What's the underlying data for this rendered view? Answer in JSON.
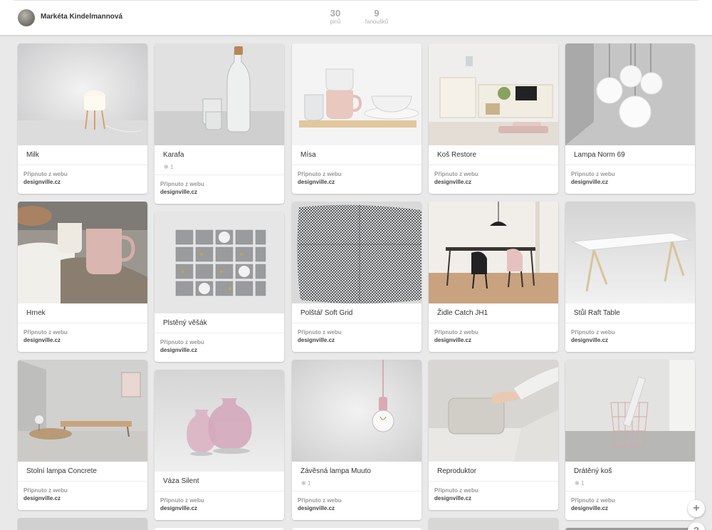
{
  "profile": {
    "name": "Markéta Kindelmannová"
  },
  "stats": [
    {
      "value": "30",
      "label": "pinů"
    },
    {
      "value": "9",
      "label": "fanoušků"
    }
  ],
  "source_label": "Připnuto z webu",
  "pins": [
    {
      "title": "Milk",
      "site": "designville.cz",
      "icon": "table-lamp-photo"
    },
    {
      "title": "Karafa",
      "site": "designville.cz",
      "likes": "1",
      "icon": "carafe-photo"
    },
    {
      "title": "Mísa",
      "site": "designville.cz",
      "icon": "bowls-mugs-photo"
    },
    {
      "title": "Koš Restore",
      "site": "designville.cz",
      "icon": "shelving-room-photo"
    },
    {
      "title": "Lampa Norm 69",
      "site": "designville.cz",
      "icon": "pendant-lamps-photo"
    },
    {
      "title": "Hrnek",
      "site": "designville.cz",
      "icon": "mug-photo"
    },
    {
      "title": "Plstěný věšák",
      "site": "designville.cz",
      "icon": "felt-hanger-photo"
    },
    {
      "title": "Polštář Soft Grid",
      "site": "designville.cz",
      "icon": "cushion-photo"
    },
    {
      "title": "Židle Catch JH1",
      "site": "designville.cz",
      "icon": "dining-room-photo"
    },
    {
      "title": "Stůl Raft Table",
      "site": "designville.cz",
      "icon": "table-photo"
    },
    {
      "title": "Stolní lampa Concrete",
      "site": "designville.cz",
      "icon": "daybed-room-photo"
    },
    {
      "title": "Váza Silent",
      "site": "designville.cz",
      "icon": "vases-photo"
    },
    {
      "title": "Závěsná lampa Muuto",
      "site": "designville.cz",
      "likes": "1",
      "icon": "bulb-lamp-photo"
    },
    {
      "title": "Reproduktor",
      "site": "designville.cz",
      "icon": "speaker-photo"
    },
    {
      "title": "Drátěný koš",
      "site": "designville.cz",
      "likes": "1",
      "icon": "wire-basket-photo"
    }
  ],
  "fab_add": "+",
  "fab_help": "?",
  "colors": {
    "background": "#e9e9e9",
    "card": "#ffffff",
    "muted_text": "#999999"
  }
}
